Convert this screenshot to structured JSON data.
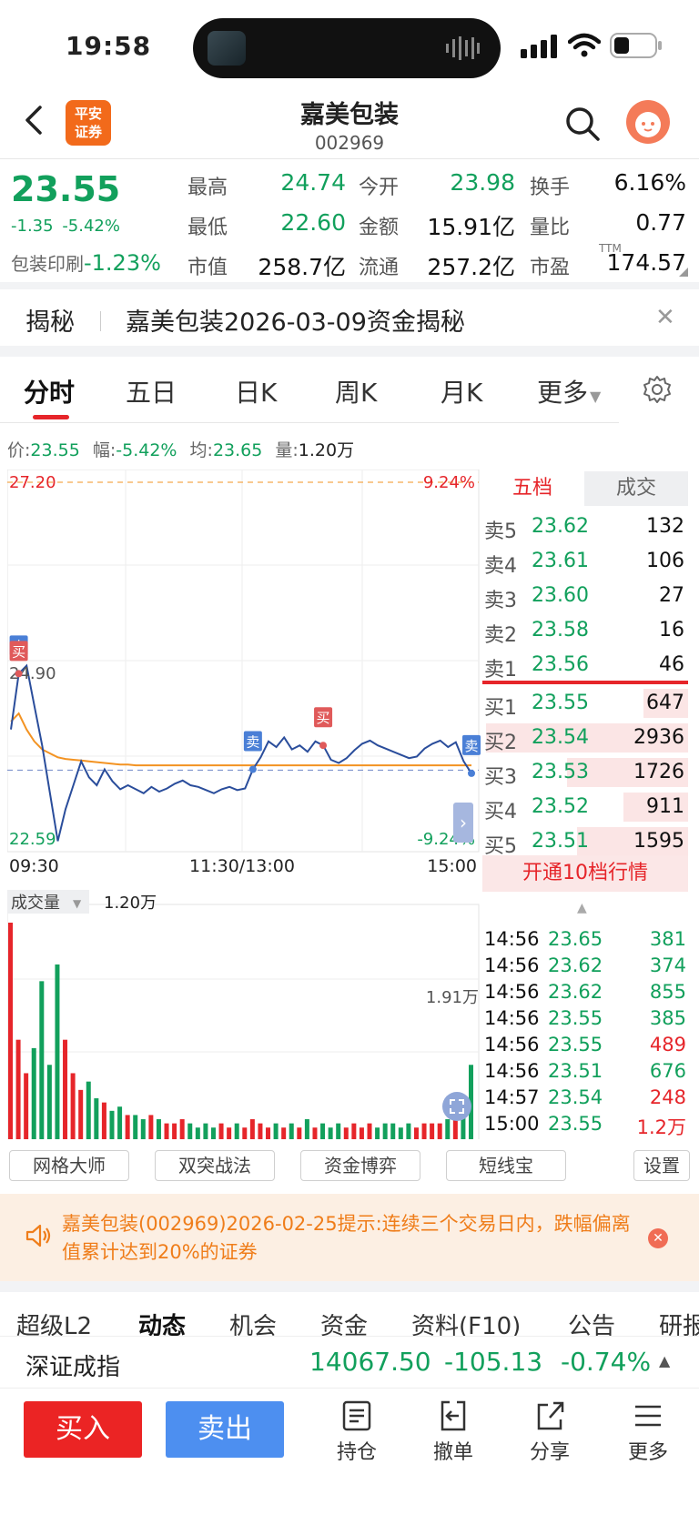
{
  "status_bar": {
    "time": "19:58"
  },
  "header": {
    "broker_logo": "平安证券",
    "broker_logo_l1": "平安",
    "broker_logo_l2": "证券",
    "stock_name": "嘉美包装",
    "stock_code": "002969"
  },
  "quote": {
    "price": "23.55",
    "change": "-1.35",
    "change_pct": "-5.42%",
    "industry_name": "包装印刷",
    "industry_pct": "-1.23%",
    "fields": [
      {
        "label": "最高",
        "value": "24.74",
        "color": "#12a05c"
      },
      {
        "label": "今开",
        "value": "23.98",
        "color": "#12a05c"
      },
      {
        "label": "换手",
        "value": "6.16%",
        "color": "#111111"
      },
      {
        "label": "最低",
        "value": "22.60",
        "color": "#12a05c"
      },
      {
        "label": "金额",
        "value": "15.91亿",
        "color": "#111111"
      },
      {
        "label": "量比",
        "value": "0.77",
        "color": "#111111"
      },
      {
        "label": "市值",
        "value": "258.7亿",
        "color": "#111111"
      },
      {
        "label": "流通",
        "value": "257.2亿",
        "color": "#111111"
      },
      {
        "label": "市盈",
        "value": "174.57",
        "color": "#111111"
      }
    ],
    "pe_superscript": "TTM"
  },
  "reveal": {
    "title": "揭秘",
    "text": "嘉美包装2026-03-09资金揭秘"
  },
  "tabs": [
    "分时",
    "五日",
    "日K",
    "周K",
    "月K",
    "更多"
  ],
  "info_line": {
    "price_label": "价:",
    "price": "23.55",
    "amp_label": "幅:",
    "amp": "-5.42%",
    "avg_label": "均:",
    "avg": "23.65",
    "vol_label": "量:",
    "vol": "1.20万"
  },
  "chart": {
    "y_top": "27.20",
    "y_bottom": "22.59",
    "y_mid": "24.90",
    "pct_top": "9.24%",
    "pct_bottom": "-9.24%",
    "time_start": "09:30",
    "time_mid": "11:30/13:00",
    "time_end": "15:00",
    "sell_marker": "卖",
    "buy_marker": "买",
    "volume_label": "成交量",
    "volume_value": "1.20万",
    "volume_max": "1.91万"
  },
  "chart_data": {
    "type": "line",
    "title": "",
    "xlabel": "",
    "ylabel": "",
    "ylim": [
      22.59,
      27.2
    ],
    "x_ticks": [
      "09:30",
      "11:30/13:00",
      "15:00"
    ],
    "series": [
      {
        "name": "价",
        "values": [
          24.1,
          24.8,
          24.9,
          24.4,
          23.9,
          23.3,
          22.7,
          23.1,
          23.4,
          23.7,
          23.5,
          23.4,
          23.6,
          23.45,
          23.35,
          23.4,
          23.35,
          23.3,
          23.38,
          23.32,
          23.36,
          23.42,
          23.46,
          23.4,
          23.38,
          23.34,
          23.3,
          23.35,
          23.38,
          23.34,
          23.36,
          23.6,
          23.75,
          23.95,
          23.88,
          24.0,
          23.85,
          23.9,
          23.82,
          23.95,
          23.9,
          23.72,
          23.68,
          23.74,
          23.84,
          23.92,
          23.96,
          23.9,
          23.86,
          23.82,
          23.78,
          23.74,
          23.76,
          23.86,
          23.92,
          23.96,
          23.88,
          23.94,
          23.7,
          23.55
        ]
      },
      {
        "name": "均",
        "values": [
          24.2,
          24.3,
          24.1,
          23.95,
          23.85,
          23.8,
          23.75,
          23.73,
          23.72,
          23.71,
          23.7,
          23.69,
          23.68,
          23.67,
          23.66,
          23.66,
          23.65,
          23.65,
          23.65,
          23.65,
          23.65,
          23.65,
          23.65,
          23.65,
          23.65,
          23.65,
          23.65,
          23.65,
          23.65,
          23.65,
          23.65,
          23.65,
          23.65,
          23.65,
          23.65,
          23.65,
          23.65,
          23.65,
          23.65,
          23.65,
          23.65,
          23.65,
          23.65,
          23.65,
          23.65,
          23.65,
          23.65,
          23.65,
          23.65,
          23.65,
          23.65,
          23.65,
          23.65,
          23.65,
          23.65,
          23.65,
          23.65,
          23.65,
          23.65,
          23.65
        ]
      }
    ],
    "volume_ylim": [
      0,
      2.6
    ],
    "volume": [
      2.6,
      1.2,
      0.8,
      1.1,
      1.9,
      0.9,
      2.1,
      1.2,
      0.8,
      0.6,
      0.7,
      0.5,
      0.45,
      0.35,
      0.4,
      0.3,
      0.3,
      0.25,
      0.3,
      0.25,
      0.2,
      0.2,
      0.25,
      0.2,
      0.15,
      0.2,
      0.15,
      0.2,
      0.15,
      0.2,
      0.15,
      0.25,
      0.2,
      0.15,
      0.2,
      0.15,
      0.2,
      0.15,
      0.25,
      0.15,
      0.2,
      0.15,
      0.2,
      0.15,
      0.2,
      0.15,
      0.2,
      0.15,
      0.2,
      0.2,
      0.15,
      0.2,
      0.15,
      0.2,
      0.2,
      0.2,
      0.25,
      0.3,
      0.5,
      0.9
    ]
  },
  "order_book": {
    "tab_five": "五档",
    "tab_trade": "成交",
    "asks": [
      {
        "label": "卖5",
        "price": "23.62",
        "vol": "132"
      },
      {
        "label": "卖4",
        "price": "23.61",
        "vol": "106"
      },
      {
        "label": "卖3",
        "price": "23.60",
        "vol": "27"
      },
      {
        "label": "卖2",
        "price": "23.58",
        "vol": "16"
      },
      {
        "label": "卖1",
        "price": "23.56",
        "vol": "46"
      }
    ],
    "bids": [
      {
        "label": "买1",
        "price": "23.55",
        "vol": "647",
        "depth": 0.22
      },
      {
        "label": "买2",
        "price": "23.54",
        "vol": "2936",
        "depth": 1.0
      },
      {
        "label": "买3",
        "price": "23.53",
        "vol": "1726",
        "depth": 0.6
      },
      {
        "label": "买4",
        "price": "23.52",
        "vol": "911",
        "depth": 0.32
      },
      {
        "label": "买5",
        "price": "23.51",
        "vol": "1595",
        "depth": 0.55
      }
    ],
    "upgrade": "开通10档行情"
  },
  "ticks": [
    {
      "time": "14:56",
      "price": "23.65",
      "vol": "381",
      "side": "sell"
    },
    {
      "time": "14:56",
      "price": "23.62",
      "vol": "374",
      "side": "sell"
    },
    {
      "time": "14:56",
      "price": "23.62",
      "vol": "855",
      "side": "sell"
    },
    {
      "time": "14:56",
      "price": "23.55",
      "vol": "385",
      "side": "sell"
    },
    {
      "time": "14:56",
      "price": "23.55",
      "vol": "489",
      "side": "buy"
    },
    {
      "time": "14:56",
      "price": "23.51",
      "vol": "676",
      "side": "sell"
    },
    {
      "time": "14:57",
      "price": "23.54",
      "vol": "248",
      "side": "buy"
    },
    {
      "time": "15:00",
      "price": "23.55",
      "vol": "1.2万",
      "side": "buy"
    }
  ],
  "tools": [
    "网格大师",
    "双突战法",
    "资金博弈",
    "短线宝",
    "设置"
  ],
  "notice": {
    "text": "嘉美包装(002969)2026-02-25提示:连续三个交易日内，跌幅偏离值累计达到20%的证券"
  },
  "bottom_tabs": [
    "超级L2",
    "动态",
    "机会",
    "资金",
    "资料(F10)",
    "公告",
    "研报"
  ],
  "index": {
    "name": "深证成指",
    "value": "14067.50",
    "change": "-105.13",
    "pct": "-0.74%"
  },
  "actions": {
    "buy": "买入",
    "sell": "卖出",
    "position": "持仓",
    "cancel": "撤单",
    "share": "分享",
    "more": "更多"
  },
  "colors": {
    "up": "#e6252a",
    "down": "#12a05c",
    "price_line": "#2a4d9b",
    "avg_line": "#f39322",
    "buy_button": "#eb2424",
    "sell_button": "#4d8ff0"
  },
  "icons": [
    "back-icon",
    "search-icon",
    "avatar-icon",
    "settings-icon",
    "speaker-icon",
    "position-icon",
    "cancel-order-icon",
    "share-icon",
    "more-icon",
    "expand-icon"
  ]
}
